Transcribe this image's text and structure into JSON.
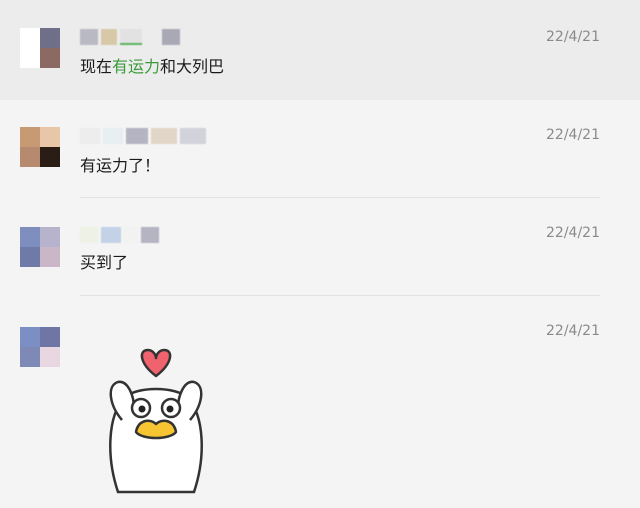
{
  "comments": [
    {
      "time": "22/4/21",
      "segments": [
        {
          "text": "现在",
          "highlight": false
        },
        {
          "text": "有运力",
          "highlight": true
        },
        {
          "text": "和大列巴",
          "highlight": false
        }
      ]
    },
    {
      "time": "22/4/21",
      "segments": [
        {
          "text": "有运力了！",
          "highlight": false
        }
      ]
    },
    {
      "time": "22/4/21",
      "segments": [
        {
          "text": "买到了",
          "highlight": false
        }
      ]
    },
    {
      "time": "22/4/21",
      "sticker": "duck-heart-sticker"
    }
  ],
  "colors": {
    "highlight_text": "#3a9a3a",
    "time_text": "#8a8a8a",
    "selected_row": "#ececec",
    "background": "#f4f4f4"
  }
}
